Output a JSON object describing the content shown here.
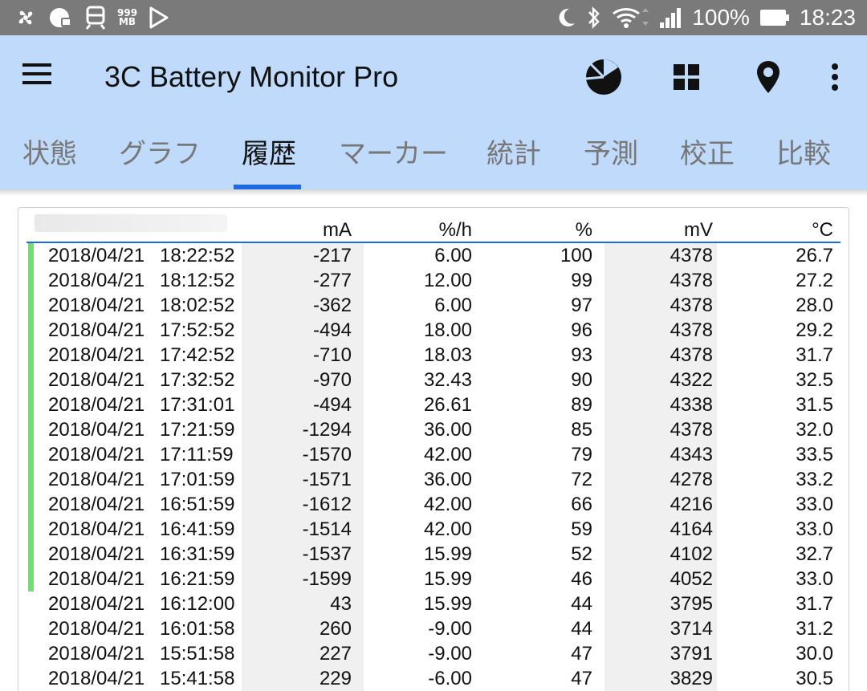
{
  "status_bar": {
    "memory_label": "999\nMB",
    "battery_percent": "100%",
    "clock": "18:23"
  },
  "app_bar": {
    "title": "3C Battery Monitor Pro"
  },
  "tabs": [
    {
      "label": "状態"
    },
    {
      "label": "グラフ"
    },
    {
      "label": "履歴"
    },
    {
      "label": "マーカー"
    },
    {
      "label": "統計"
    },
    {
      "label": "予測"
    },
    {
      "label": "校正"
    },
    {
      "label": "比較"
    }
  ],
  "active_tab": "履歴",
  "table": {
    "headers": {
      "ma": "mA",
      "rate": "%/h",
      "pct": "%",
      "mv": "mV",
      "temp": "°C"
    },
    "rows": [
      {
        "date": "2018/04/21",
        "time": "18:22:52",
        "ma": "-217",
        "rate": "6.00",
        "pct": "100",
        "mv": "4378",
        "temp": "26.7",
        "charging": true
      },
      {
        "date": "2018/04/21",
        "time": "18:12:52",
        "ma": "-277",
        "rate": "12.00",
        "pct": "99",
        "mv": "4378",
        "temp": "27.2",
        "charging": true
      },
      {
        "date": "2018/04/21",
        "time": "18:02:52",
        "ma": "-362",
        "rate": "6.00",
        "pct": "97",
        "mv": "4378",
        "temp": "28.0",
        "charging": true
      },
      {
        "date": "2018/04/21",
        "time": "17:52:52",
        "ma": "-494",
        "rate": "18.00",
        "pct": "96",
        "mv": "4378",
        "temp": "29.2",
        "charging": true
      },
      {
        "date": "2018/04/21",
        "time": "17:42:52",
        "ma": "-710",
        "rate": "18.03",
        "pct": "93",
        "mv": "4378",
        "temp": "31.7",
        "charging": true
      },
      {
        "date": "2018/04/21",
        "time": "17:32:52",
        "ma": "-970",
        "rate": "32.43",
        "pct": "90",
        "mv": "4322",
        "temp": "32.5",
        "charging": true
      },
      {
        "date": "2018/04/21",
        "time": "17:31:01",
        "ma": "-494",
        "rate": "26.61",
        "pct": "89",
        "mv": "4338",
        "temp": "31.5",
        "charging": true
      },
      {
        "date": "2018/04/21",
        "time": "17:21:59",
        "ma": "-1294",
        "rate": "36.00",
        "pct": "85",
        "mv": "4378",
        "temp": "32.0",
        "charging": true
      },
      {
        "date": "2018/04/21",
        "time": "17:11:59",
        "ma": "-1570",
        "rate": "42.00",
        "pct": "79",
        "mv": "4343",
        "temp": "33.5",
        "charging": true
      },
      {
        "date": "2018/04/21",
        "time": "17:01:59",
        "ma": "-1571",
        "rate": "36.00",
        "pct": "72",
        "mv": "4278",
        "temp": "33.2",
        "charging": true
      },
      {
        "date": "2018/04/21",
        "time": "16:51:59",
        "ma": "-1612",
        "rate": "42.00",
        "pct": "66",
        "mv": "4216",
        "temp": "33.0",
        "charging": true
      },
      {
        "date": "2018/04/21",
        "time": "16:41:59",
        "ma": "-1514",
        "rate": "42.00",
        "pct": "59",
        "mv": "4164",
        "temp": "33.0",
        "charging": true
      },
      {
        "date": "2018/04/21",
        "time": "16:31:59",
        "ma": "-1537",
        "rate": "15.99",
        "pct": "52",
        "mv": "4102",
        "temp": "32.7",
        "charging": true
      },
      {
        "date": "2018/04/21",
        "time": "16:21:59",
        "ma": "-1599",
        "rate": "15.99",
        "pct": "46",
        "mv": "4052",
        "temp": "33.0",
        "charging": true
      },
      {
        "date": "2018/04/21",
        "time": "16:12:00",
        "ma": "43",
        "rate": "15.99",
        "pct": "44",
        "mv": "3795",
        "temp": "31.7",
        "charging": false
      },
      {
        "date": "2018/04/21",
        "time": "16:01:58",
        "ma": "260",
        "rate": "-9.00",
        "pct": "44",
        "mv": "3714",
        "temp": "31.2",
        "charging": false
      },
      {
        "date": "2018/04/21",
        "time": "15:51:58",
        "ma": "227",
        "rate": "-9.00",
        "pct": "47",
        "mv": "3791",
        "temp": "30.0",
        "charging": false
      },
      {
        "date": "2018/04/21",
        "time": "15:41:58",
        "ma": "229",
        "rate": "-6.00",
        "pct": "47",
        "mv": "3829",
        "temp": "30.5",
        "charging": false
      }
    ]
  },
  "colors": {
    "app_bar_bg": "#bfdafb",
    "accent": "#1f6ae0",
    "charging_indicator": "#6de06d",
    "status_bar_bg": "#7a7a7a"
  },
  "icons": {
    "status_left": [
      "pinwheel-icon",
      "cloud-sync-icon",
      "train-icon",
      "memory-icon",
      "play-store-icon"
    ],
    "status_right": [
      "moon-icon",
      "bluetooth-icon",
      "wifi-icon",
      "signal-icon",
      "battery-icon"
    ],
    "toolbar": [
      "menu-icon",
      "pie-chart-icon",
      "grid-icon",
      "location-pin-icon",
      "more-vert-icon"
    ]
  }
}
